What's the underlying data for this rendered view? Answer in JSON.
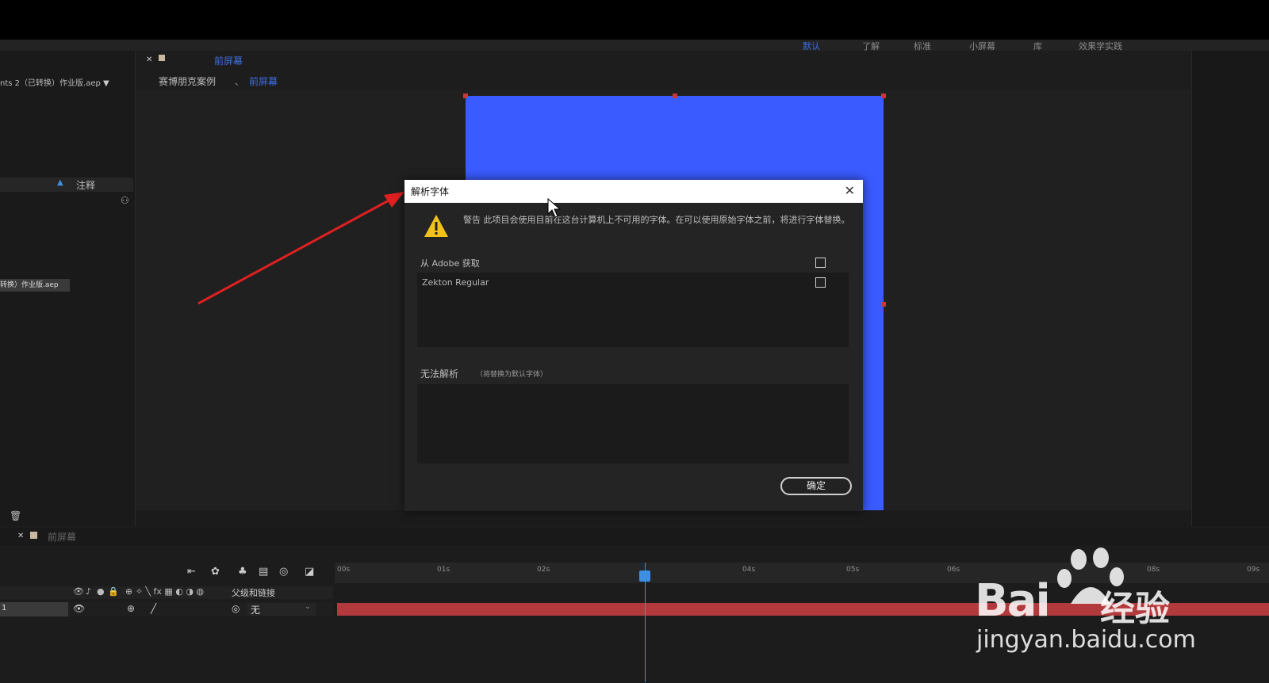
{
  "workspaces": [
    {
      "label": "默认",
      "active": true
    },
    {
      "label": "了解",
      "active": false
    },
    {
      "label": "标准",
      "active": false
    },
    {
      "label": "小屏幕",
      "active": false
    },
    {
      "label": "库",
      "active": false
    },
    {
      "label": "效果学实践",
      "active": false
    }
  ],
  "project": {
    "name": "nts 2（已转换）作业版.aep",
    "annotation_label": "注释",
    "file_item": "转换）作业版.aep"
  },
  "composition": {
    "tab_label": "前屏幕",
    "breadcrumb": [
      "赛博朋克案例",
      "前屏幕"
    ],
    "breadcrumb_sep": "、",
    "background_color": "#3a5bff"
  },
  "dialog": {
    "title": "解析字体",
    "warning": "警告 此项目会使用目前在这台计算机上不可用的字体。在可以使用原始字体之前，将进行字体替换。",
    "adobe_section": "从 Adobe 获取",
    "fonts": [
      "Zekton Regular"
    ],
    "unresolved_label": "无法解析",
    "unresolved_note": "（将替换为默认字体）",
    "ok_button": "确定"
  },
  "timeline": {
    "tab_label": "前屏幕",
    "column_parent": "父级和链接",
    "layer_number": "1",
    "layer_parent_value": "无",
    "ruler_ticks": [
      "00s",
      "01s",
      "02s",
      "03s",
      "04s",
      "05s",
      "06s",
      "07s",
      "08s",
      "09s"
    ],
    "playhead_time_seconds": 3
  },
  "watermark": {
    "brand": "Bai",
    "brand2": "经验",
    "url": "jingyan.baidu.com"
  },
  "colors": {
    "accent": "#3f6ee0",
    "layer_bar": "#b23a3c",
    "annotation_arrow": "#e02020"
  }
}
